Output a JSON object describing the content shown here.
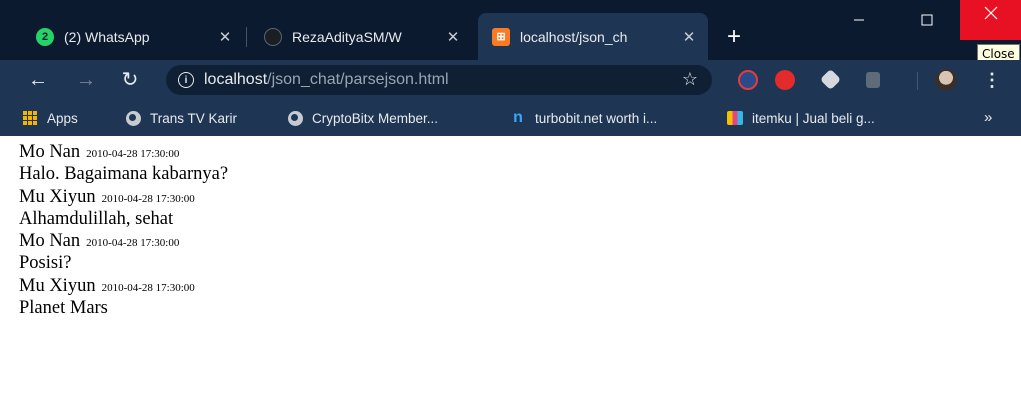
{
  "browser": {
    "tabs": [
      {
        "title": "(2) WhatsApp",
        "favicon_text": "2",
        "favicon_color": "#25d366",
        "active": false
      },
      {
        "title": "RezaAdityaSM/W",
        "favicon_text": "",
        "favicon_color": "#1b1f23",
        "active": false
      },
      {
        "title": "localhost/json_ch",
        "favicon_text": "⊞",
        "favicon_color": "#fb7a24",
        "active": true
      }
    ],
    "new_tab_label": "+",
    "close_tooltip": "Close",
    "address": {
      "host": "localhost",
      "path": "/json_chat/parsejson.html"
    },
    "bookmarks": [
      {
        "label": "Apps",
        "icon": "apps-grid-icon"
      },
      {
        "label": "Trans TV Karir",
        "icon": "globe-icon"
      },
      {
        "label": "CryptoBitx Member...",
        "icon": "globe-icon"
      },
      {
        "label": "turbobit.net worth i...",
        "icon": "turbobit-icon"
      },
      {
        "label": "itemku | Jual beli g...",
        "icon": "itemku-icon"
      }
    ],
    "bookmarks_overflow": "»",
    "theme": {
      "frame": "#0c1a2f",
      "toolbar": "#1e3654",
      "omnibox": "#0f2035",
      "close_red": "#e81123"
    }
  },
  "chat": {
    "messages": [
      {
        "sender": "Mo Nan",
        "time": "2010-04-28 17:30:00",
        "text": "Halo. Bagaimana kabarnya?"
      },
      {
        "sender": "Mu Xiyun",
        "time": "2010-04-28 17:30:00",
        "text": "Alhamdulillah, sehat"
      },
      {
        "sender": "Mo Nan",
        "time": "2010-04-28 17:30:00",
        "text": "Posisi?"
      },
      {
        "sender": "Mu Xiyun",
        "time": "2010-04-28 17:30:00",
        "text": "Planet Mars"
      }
    ]
  }
}
